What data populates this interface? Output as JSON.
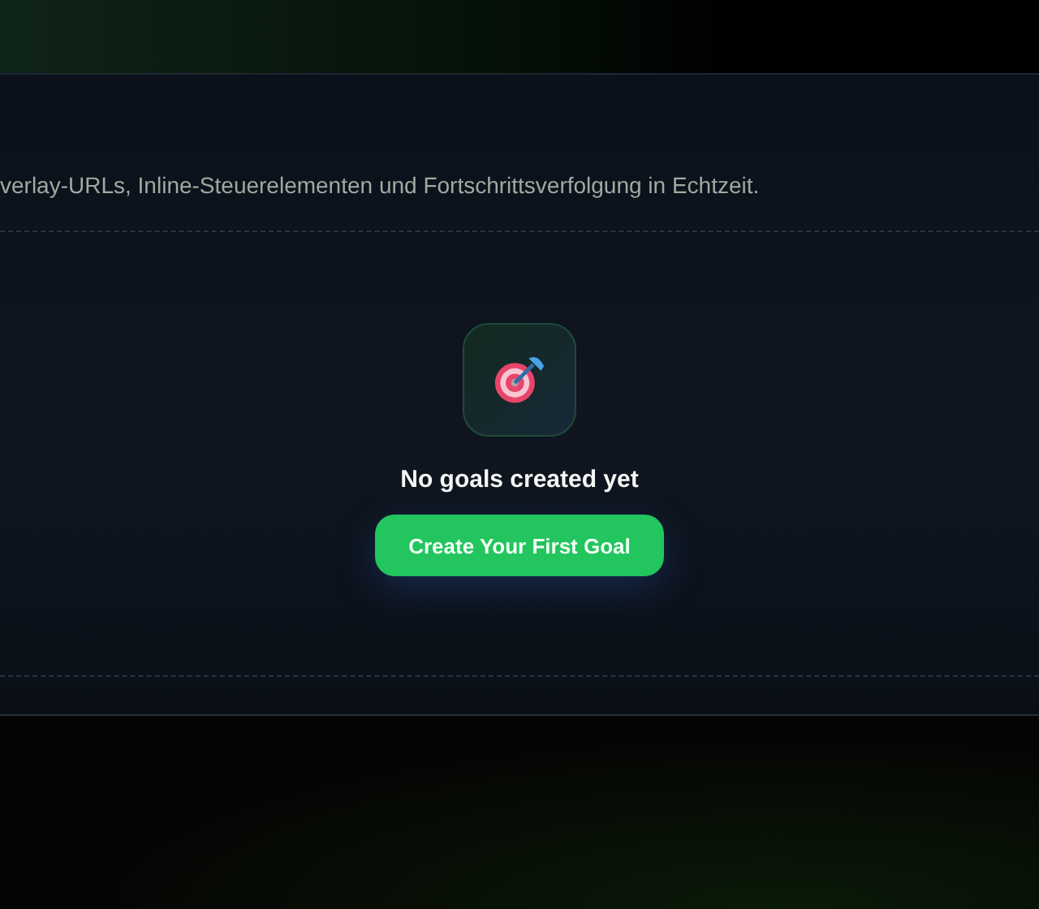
{
  "description": "verlay-URLs, Inline-Steuerelementen und Fortschrittsverfolgung in Echtzeit.",
  "empty_state": {
    "title": "No goals created yet",
    "button": "Create Your First Goal"
  }
}
